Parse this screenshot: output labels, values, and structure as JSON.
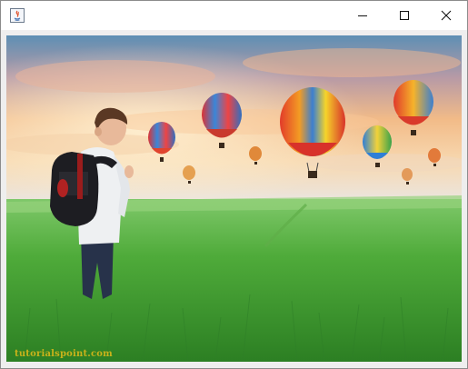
{
  "window": {
    "title": "",
    "controls": {
      "minimize_icon": "minimize-icon",
      "maximize_icon": "maximize-icon",
      "close_icon": "close-icon"
    }
  },
  "image": {
    "watermark": "tutorialspoint.com"
  },
  "colors": {
    "titlebar": "#ffffff",
    "frame": "#eeeeee",
    "watermark": "#c9b21a"
  }
}
